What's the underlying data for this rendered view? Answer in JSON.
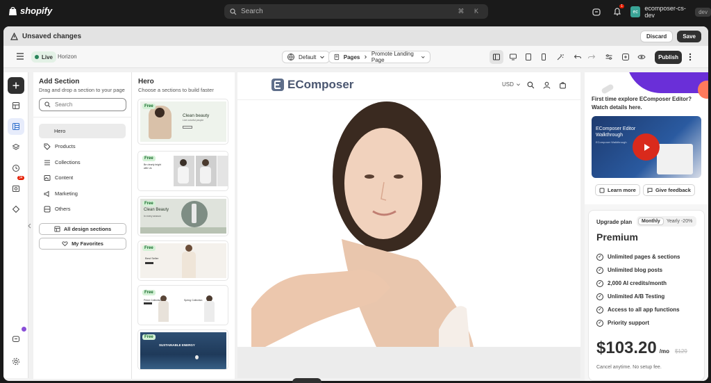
{
  "topbar": {
    "brand": "shopify",
    "search_placeholder": "Search",
    "shortcut": "⌘ K",
    "notification_count": "1",
    "store_initials": "ec",
    "store_name": "ecomposer-cs-dev",
    "env_tag": "dev"
  },
  "unsaved": {
    "label": "Unsaved changes",
    "discard": "Discard",
    "save": "Save"
  },
  "editor": {
    "status": "Live",
    "theme": "Horizon",
    "template": "Default",
    "pages": "Pages",
    "page_name": "Promote Landing Page",
    "publish": "Publish"
  },
  "rail": {
    "badge": "34"
  },
  "add_section": {
    "title": "Add Section",
    "subtitle": "Drag and drop a section to your page",
    "search_placeholder": "Search",
    "categories": [
      "Hero",
      "Products",
      "Collections",
      "Content",
      "Marketing",
      "Others"
    ],
    "all_sections": "All design sections",
    "favorites": "My Favorites"
  },
  "hero_list": {
    "title": "Hero",
    "subtitle": "Choose a sections to build faster",
    "free_label": "Free",
    "cards": [
      {
        "text": "Clean beauty",
        "sub": "Live colorful people"
      },
      {
        "text": "Be clearly bright with Us"
      },
      {
        "text": "Clean Beauty",
        "sub": "In every season"
      },
      {
        "text": "Best Seller"
      },
      {
        "text": "Prime Collection",
        "text2": "Spring Collection"
      },
      {
        "text": "SUSTAINABLE ENERGY"
      }
    ]
  },
  "store": {
    "brand": "EComposer",
    "currency": "USD"
  },
  "promo": {
    "headline": "First time explore EComposer Editor? Watch details here.",
    "video_title": "EComposer Editor Walkthrough",
    "video_sub": "EComposer Walkthrough",
    "learn_more": "Learn more",
    "feedback": "Give feedback",
    "upgrade": "Upgrade plan",
    "monthly": "Monthly",
    "yearly": "Yearly -20%",
    "plan": "Premium",
    "features": [
      "Unlimited pages & sections",
      "Unlimited blog posts",
      "2,000 AI credits/month",
      "Unlimited A/B Testing",
      "Access to all app functions",
      "Priority support"
    ],
    "price": "$103.20",
    "per": "/mo",
    "old_price": "$129",
    "cancel_note": "Cancel anytime. No setup fee."
  }
}
